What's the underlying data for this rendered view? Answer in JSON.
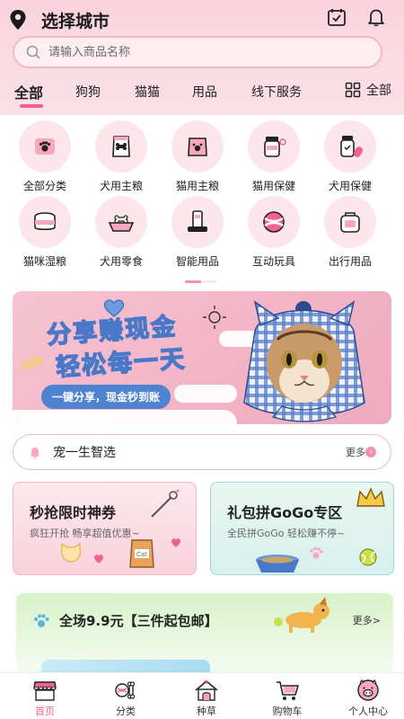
{
  "header": {
    "city_label": "选择城市",
    "search_placeholder": "请输入商品名称"
  },
  "tabs": [
    {
      "label": "全部",
      "active": true
    },
    {
      "label": "狗狗"
    },
    {
      "label": "猫猫"
    },
    {
      "label": "用品"
    },
    {
      "label": "线下服务"
    }
  ],
  "tabs_all_label": "全部",
  "categories": [
    {
      "label": "全部分类",
      "icon": "paw-box-icon"
    },
    {
      "label": "犬用主粮",
      "icon": "dog-food-bag-icon"
    },
    {
      "label": "猫用主粮",
      "icon": "cat-food-bag-icon"
    },
    {
      "label": "猫用保健",
      "icon": "supplement-jar-icon"
    },
    {
      "label": "犬用保健",
      "icon": "medicine-bottle-icon"
    },
    {
      "label": "猫咪湿粮",
      "icon": "canned-food-icon"
    },
    {
      "label": "犬用零食",
      "icon": "treat-bowl-icon"
    },
    {
      "label": "智能用品",
      "icon": "smart-feeder-icon"
    },
    {
      "label": "互动玩具",
      "icon": "ball-toy-icon"
    },
    {
      "label": "出行用品",
      "icon": "pet-carrier-icon"
    }
  ],
  "banner": {
    "line1": "分享赚现金",
    "line2": "轻松每一天",
    "pill": "一键分享，现金秒到账"
  },
  "section": {
    "title": "宠一生智选",
    "more": "更多"
  },
  "cards": [
    {
      "title": "秒抢限时神券",
      "subtitle": "疯狂开抢  畅享超值优惠~"
    },
    {
      "title": "礼包拼GoGo专区",
      "subtitle": "全民拼GoGo  轻松赚不停~"
    }
  ],
  "promo": {
    "title": "全场9.9元【三件起包邮】",
    "more": "更多>"
  },
  "bottom_nav": [
    {
      "label": "首页",
      "icon": "shop-home-icon",
      "active": true
    },
    {
      "label": "分类",
      "icon": "category-ball-bone-icon"
    },
    {
      "label": "种草",
      "icon": "pet-house-icon"
    },
    {
      "label": "购物车",
      "icon": "cart-icon"
    },
    {
      "label": "个人中心",
      "icon": "pig-face-icon"
    }
  ],
  "colors": {
    "accent": "#f06292",
    "header_bg": "#f9d3de",
    "promo_green": "#d7f2c9"
  }
}
